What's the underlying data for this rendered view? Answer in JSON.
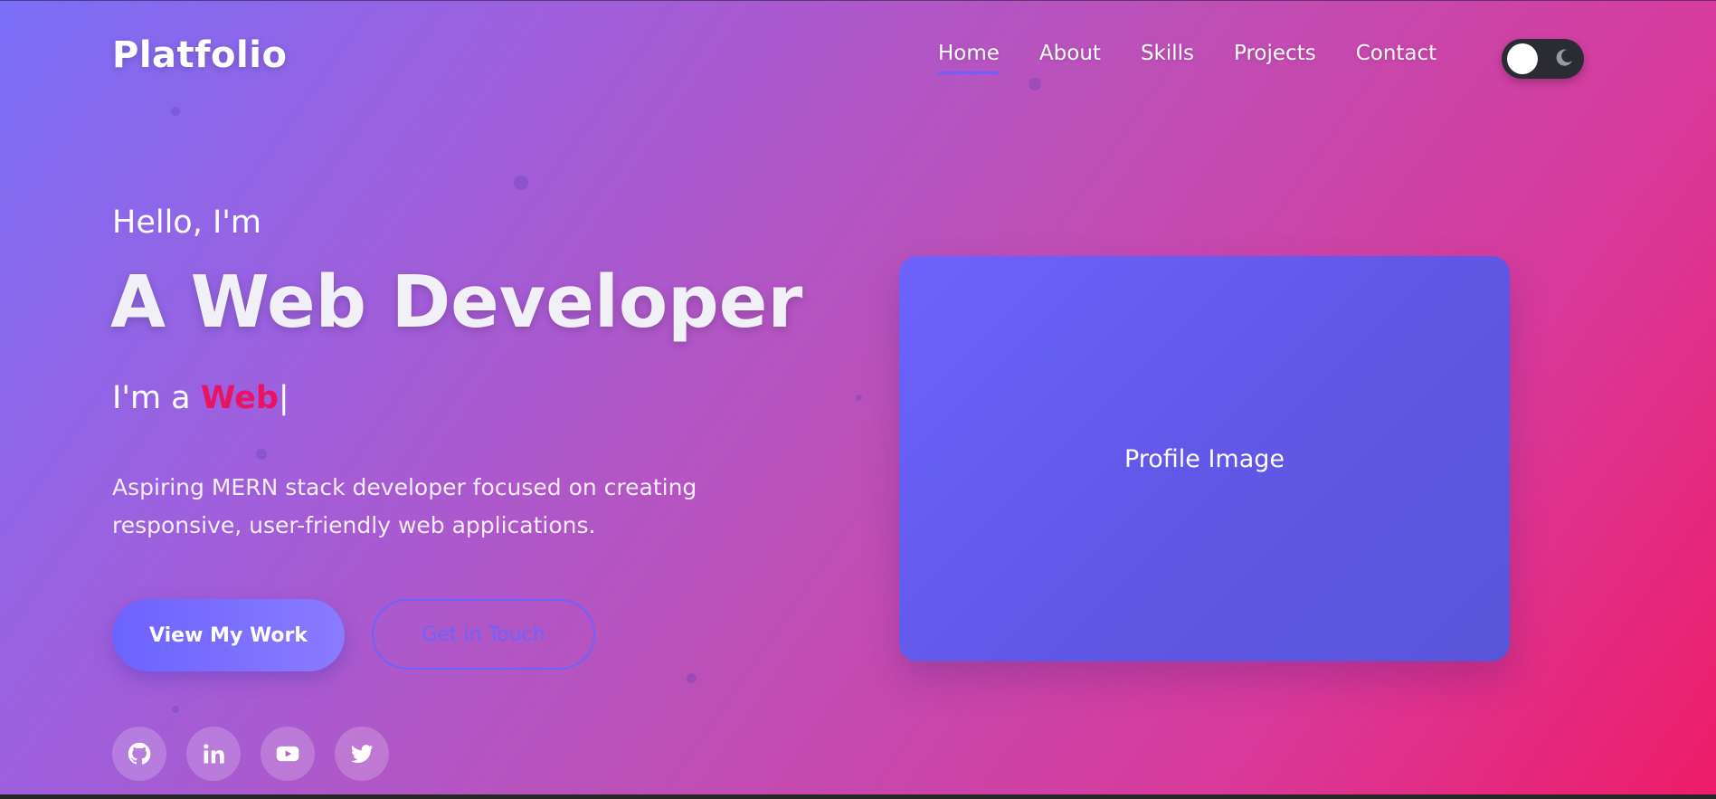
{
  "header": {
    "logo": "Platfolio",
    "nav": [
      {
        "label": "Home",
        "active": true
      },
      {
        "label": "About",
        "active": false
      },
      {
        "label": "Skills",
        "active": false
      },
      {
        "label": "Projects",
        "active": false
      },
      {
        "label": "Contact",
        "active": false
      }
    ],
    "theme_toggle": {
      "state": "light",
      "knob_icon": "sun-knob-icon",
      "moon_icon": "moon-icon"
    }
  },
  "hero": {
    "greeting": "Hello, I'm",
    "headline": "A Web Developer",
    "typed_prefix": "I'm a ",
    "typed_word": "Web",
    "typed_cursor": "|",
    "description": "Aspiring MERN stack developer focused on creating responsive, user-friendly web applications.",
    "primary_button": "View My Work",
    "secondary_button": "Get in Touch",
    "socials": [
      {
        "name": "github-icon"
      },
      {
        "name": "linkedin-icon"
      },
      {
        "name": "youtube-icon"
      },
      {
        "name": "twitter-icon"
      }
    ]
  },
  "profile": {
    "label": "Profile Image"
  },
  "colors": {
    "accent": "#6c63ff",
    "highlight": "#ea1262",
    "gradient_start": "#7a6ff7",
    "gradient_end": "#ee1c68"
  }
}
